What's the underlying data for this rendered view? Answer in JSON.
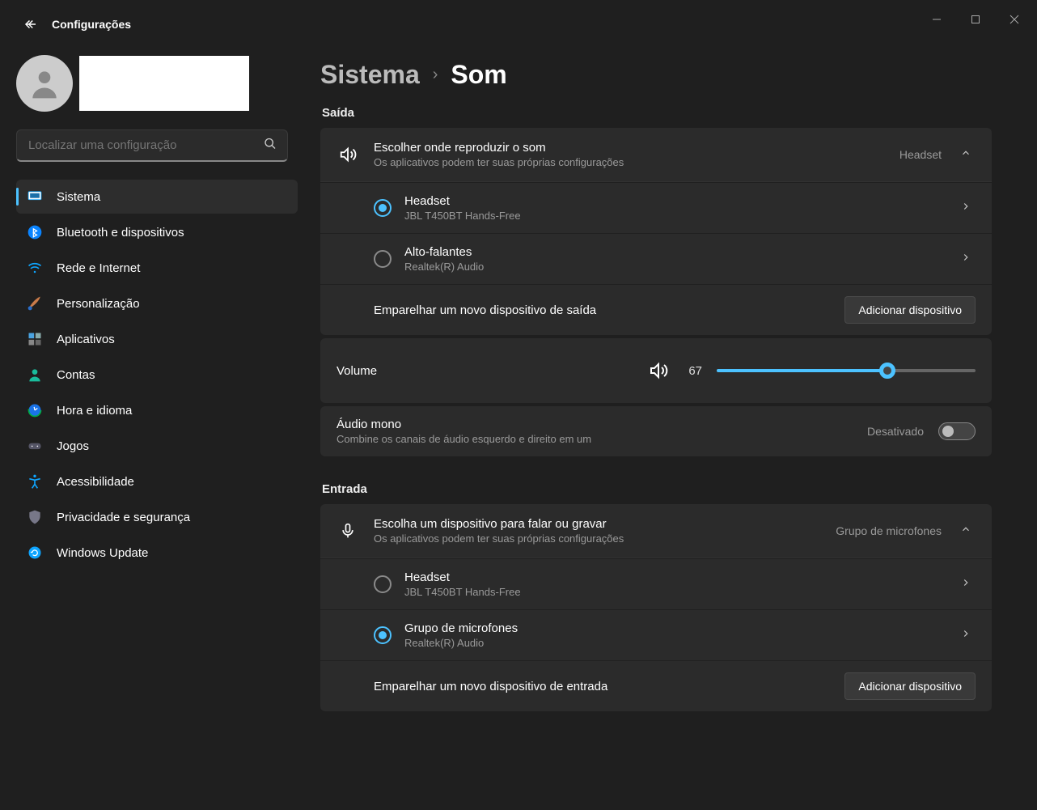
{
  "app": {
    "title": "Configurações"
  },
  "search": {
    "placeholder": "Localizar uma configuração"
  },
  "nav": [
    {
      "label": "Sistema",
      "active": true,
      "icon": "monitor"
    },
    {
      "label": "Bluetooth e dispositivos",
      "icon": "bluetooth"
    },
    {
      "label": "Rede e Internet",
      "icon": "wifi"
    },
    {
      "label": "Personalização",
      "icon": "brush"
    },
    {
      "label": "Aplicativos",
      "icon": "apps"
    },
    {
      "label": "Contas",
      "icon": "person"
    },
    {
      "label": "Hora e idioma",
      "icon": "clock"
    },
    {
      "label": "Jogos",
      "icon": "gamepad"
    },
    {
      "label": "Acessibilidade",
      "icon": "accessibility"
    },
    {
      "label": "Privacidade e segurança",
      "icon": "shield"
    },
    {
      "label": "Windows Update",
      "icon": "update"
    }
  ],
  "breadcrumb": {
    "root": "Sistema",
    "current": "Som"
  },
  "output": {
    "section": "Saída",
    "choose_title": "Escolher onde reproduzir o som",
    "choose_sub": "Os aplicativos podem ter suas próprias configurações",
    "choose_value": "Headset",
    "devices": [
      {
        "title": "Headset",
        "sub": "JBL T450BT Hands-Free",
        "selected": true
      },
      {
        "title": "Alto-falantes",
        "sub": "Realtek(R) Audio",
        "selected": false
      }
    ],
    "pair_label": "Emparelhar um novo dispositivo de saída",
    "add_button": "Adicionar dispositivo"
  },
  "volume": {
    "label": "Volume",
    "value": 67
  },
  "mono": {
    "title": "Áudio mono",
    "sub": "Combine os canais de áudio esquerdo e direito em um",
    "state": "Desativado"
  },
  "input": {
    "section": "Entrada",
    "choose_title": "Escolha um dispositivo para falar ou gravar",
    "choose_sub": "Os aplicativos podem ter suas próprias configurações",
    "choose_value": "Grupo de microfones",
    "devices": [
      {
        "title": "Headset",
        "sub": "JBL T450BT Hands-Free",
        "selected": false
      },
      {
        "title": "Grupo de microfones",
        "sub": "Realtek(R) Audio",
        "selected": true
      }
    ],
    "pair_label": "Emparelhar um novo dispositivo de entrada",
    "add_button": "Adicionar dispositivo"
  }
}
